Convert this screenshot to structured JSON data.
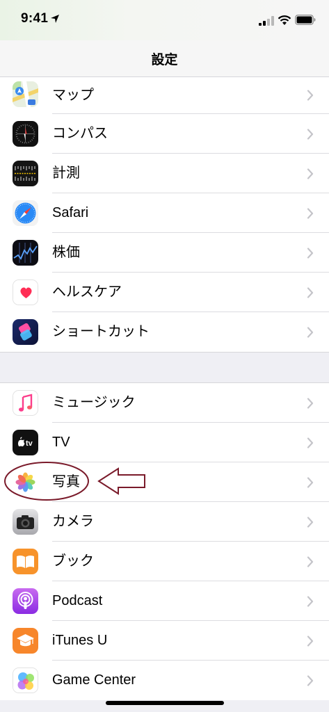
{
  "status_bar": {
    "time": "9:41"
  },
  "nav": {
    "title": "設定"
  },
  "groups": [
    {
      "items": [
        {
          "label": "マップ",
          "icon": "maps-icon"
        },
        {
          "label": "コンパス",
          "icon": "compass-icon"
        },
        {
          "label": "計測",
          "icon": "measure-icon"
        },
        {
          "label": "Safari",
          "icon": "safari-icon"
        },
        {
          "label": "株価",
          "icon": "stocks-icon"
        },
        {
          "label": "ヘルスケア",
          "icon": "health-icon"
        },
        {
          "label": "ショートカット",
          "icon": "shortcuts-icon"
        }
      ]
    },
    {
      "items": [
        {
          "label": "ミュージック",
          "icon": "music-icon"
        },
        {
          "label": "TV",
          "icon": "tv-icon"
        },
        {
          "label": "写真",
          "icon": "photos-icon"
        },
        {
          "label": "カメラ",
          "icon": "camera-icon"
        },
        {
          "label": "ブック",
          "icon": "books-icon"
        },
        {
          "label": "Podcast",
          "icon": "podcast-icon"
        },
        {
          "label": "iTunes U",
          "icon": "itunes-u-icon"
        },
        {
          "label": "Game Center",
          "icon": "game-center-icon"
        }
      ]
    }
  ],
  "annotation": {
    "target": "写真",
    "shapes": [
      "red-ellipse",
      "left-arrow"
    ],
    "color": "#7a1a2a"
  },
  "colors": {
    "background": "#efeff4",
    "chevron": "#c4c4c9",
    "separator": "#dcdce0"
  }
}
